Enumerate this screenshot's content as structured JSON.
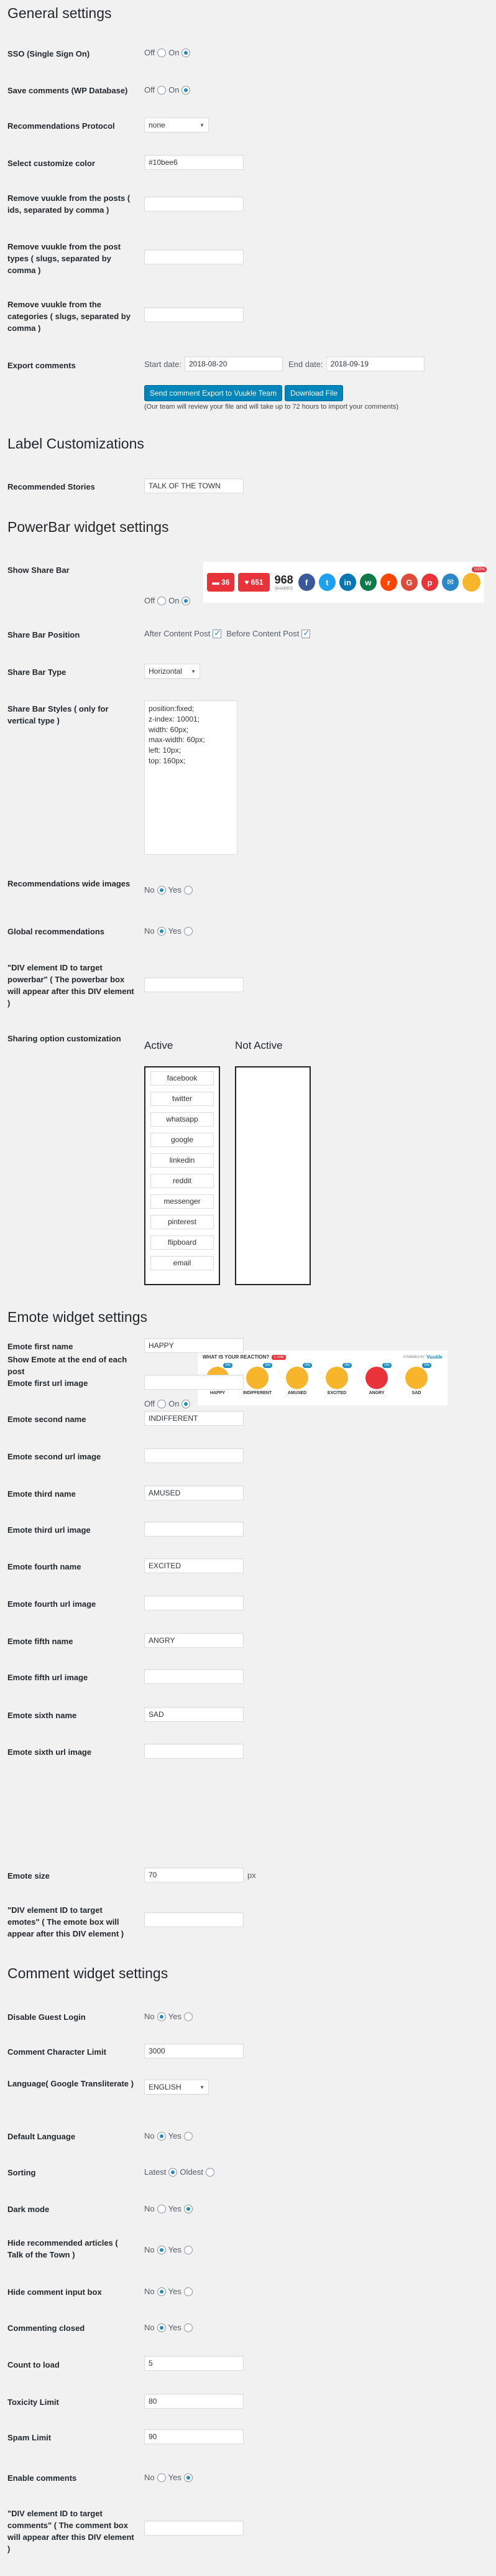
{
  "general": {
    "title": "General settings",
    "sso": {
      "label": "SSO (Single Sign On)",
      "off": "Off",
      "on": "On"
    },
    "save_comments": {
      "label": "Save comments (WP Database)",
      "off": "Off",
      "on": "On"
    },
    "reco_protocol": {
      "label": "Recommendations Protocol",
      "value": "none"
    },
    "customize_color": {
      "label": "Select customize color",
      "value": "#10bee6"
    },
    "remove_posts": {
      "label": "Remove vuukle from the posts ( ids, separated by comma )",
      "value": ""
    },
    "remove_post_types": {
      "label": "Remove vuukle from the post types ( slugs, separated by comma )",
      "value": ""
    },
    "remove_categories": {
      "label": "Remove vuukle from the categories ( slugs, separated by comma )",
      "value": ""
    },
    "export": {
      "label": "Export comments",
      "start_label": "Start date:",
      "start_value": "2018-08-20",
      "end_label": "End date:",
      "end_value": "2018-09-19",
      "send_button": "Send comment Export to Vuukle Team",
      "download_button": "Download File",
      "note": "(Our team will review your file and will take up to 72 hours to import your comments)"
    }
  },
  "label_custom": {
    "title": "Label Customizations",
    "recommended": {
      "label": "Recommended Stories",
      "value": "TALK OF THE TOWN"
    }
  },
  "powerbar": {
    "title": "PowerBar widget settings",
    "show": {
      "label": "Show Share Bar",
      "off": "Off",
      "on": "On"
    },
    "preview": {
      "comments": "36",
      "likes": "651",
      "shares": "968",
      "shares_label": "SHARES",
      "badge_count": "100%"
    },
    "position": {
      "label": "Share Bar Position",
      "after": "After Content Post",
      "before": "Before Content Post"
    },
    "type": {
      "label": "Share Bar Type",
      "value": "Horizontal"
    },
    "styles": {
      "label": "Share Bar Styles ( only for vertical type )",
      "value": "position:fixed;\nz-index: 10001;\nwidth: 60px;\nmax-width: 60px;\nleft: 10px;\ntop: 160px;"
    },
    "reco_wide": {
      "label": "Recommendations wide images",
      "no": "No",
      "yes": "Yes"
    },
    "global_reco": {
      "label": "Global recommendations",
      "no": "No",
      "yes": "Yes"
    },
    "div_target": {
      "label": "\"DIV element ID to target powerbar\" ( The powerbar box will appear after this DIV element )",
      "value": ""
    },
    "sharing": {
      "label": "Sharing option customization",
      "active_title": "Active",
      "inactive_title": "Not Active",
      "active": [
        "facebook",
        "twitter",
        "whatsapp",
        "google",
        "linkedin",
        "reddit",
        "messenger",
        "pinterest",
        "flipboard",
        "email"
      ]
    }
  },
  "emote": {
    "title": "Emote widget settings",
    "show": {
      "label": "Show Emote at the end of each post",
      "off": "Off",
      "on": "On"
    },
    "preview": {
      "heading": "WHAT IS YOUR REACTION?",
      "badge": "1 vote",
      "powered": "POWERED BY",
      "brand": "Vuukle",
      "faces": [
        {
          "name": "HAPPY",
          "pct": "0%",
          "color": "#f7b52c"
        },
        {
          "name": "INDIFFERENT",
          "pct": "0%",
          "color": "#f7b52c"
        },
        {
          "name": "AMUSED",
          "pct": "0%",
          "color": "#f7b52c"
        },
        {
          "name": "EXCITED",
          "pct": "0%",
          "color": "#f7b52c"
        },
        {
          "name": "ANGRY",
          "pct": "0%",
          "color": "#e8333a"
        },
        {
          "name": "SAD",
          "pct": "0%",
          "color": "#f7b52c"
        }
      ]
    },
    "fields": [
      {
        "label": "Emote first name",
        "value": "HAPPY"
      },
      {
        "label": "Emote first url image",
        "value": ""
      },
      {
        "label": "Emote second name",
        "value": "INDIFFERENT"
      },
      {
        "label": "Emote second url image",
        "value": ""
      },
      {
        "label": "Emote third name",
        "value": "AMUSED"
      },
      {
        "label": "Emote third url image",
        "value": ""
      },
      {
        "label": "Emote fourth name",
        "value": "EXCITED"
      },
      {
        "label": "Emote fourth url image",
        "value": ""
      },
      {
        "label": "Emote fifth name",
        "value": "ANGRY"
      },
      {
        "label": "Emote fifth url image",
        "value": ""
      },
      {
        "label": "Emote sixth name",
        "value": "SAD"
      },
      {
        "label": "Emote sixth url image",
        "value": ""
      }
    ],
    "size": {
      "label": "Emote size",
      "value": "70",
      "unit": "px"
    },
    "div_target": {
      "label": "\"DIV element ID to target emotes\" ( The emote box will appear after this DIV element )",
      "value": ""
    }
  },
  "comment": {
    "title": "Comment widget settings",
    "guest_login": {
      "label": "Disable Guest Login",
      "no": "No",
      "yes": "Yes"
    },
    "char_limit": {
      "label": "Comment Character Limit",
      "value": "3000"
    },
    "language": {
      "label": "Language( Google Transliterate )",
      "value": "ENGLISH"
    },
    "default_lang": {
      "label": "Default Language",
      "no": "No",
      "yes": "Yes"
    },
    "sorting": {
      "label": "Sorting",
      "latest": "Latest",
      "oldest": "Oldest"
    },
    "dark_mode": {
      "label": "Dark mode",
      "no": "No",
      "yes": "Yes"
    },
    "hide_reco": {
      "label": "Hide recommended articles ( Talk of the Town )",
      "no": "No",
      "yes": "Yes"
    },
    "hide_input": {
      "label": "Hide comment input box",
      "no": "No",
      "yes": "Yes"
    },
    "closed": {
      "label": "Commenting closed",
      "no": "No",
      "yes": "Yes"
    },
    "count_load": {
      "label": "Count to load",
      "value": "5"
    },
    "toxicity": {
      "label": "Toxicity Limit",
      "value": "80"
    },
    "spam": {
      "label": "Spam Limit",
      "value": "90"
    },
    "enable": {
      "label": "Enable comments",
      "no": "No",
      "yes": "Yes"
    },
    "div_target": {
      "label": "\"DIV element ID to target comments\" ( The comment box will appear after this DIV element )",
      "value": ""
    }
  }
}
